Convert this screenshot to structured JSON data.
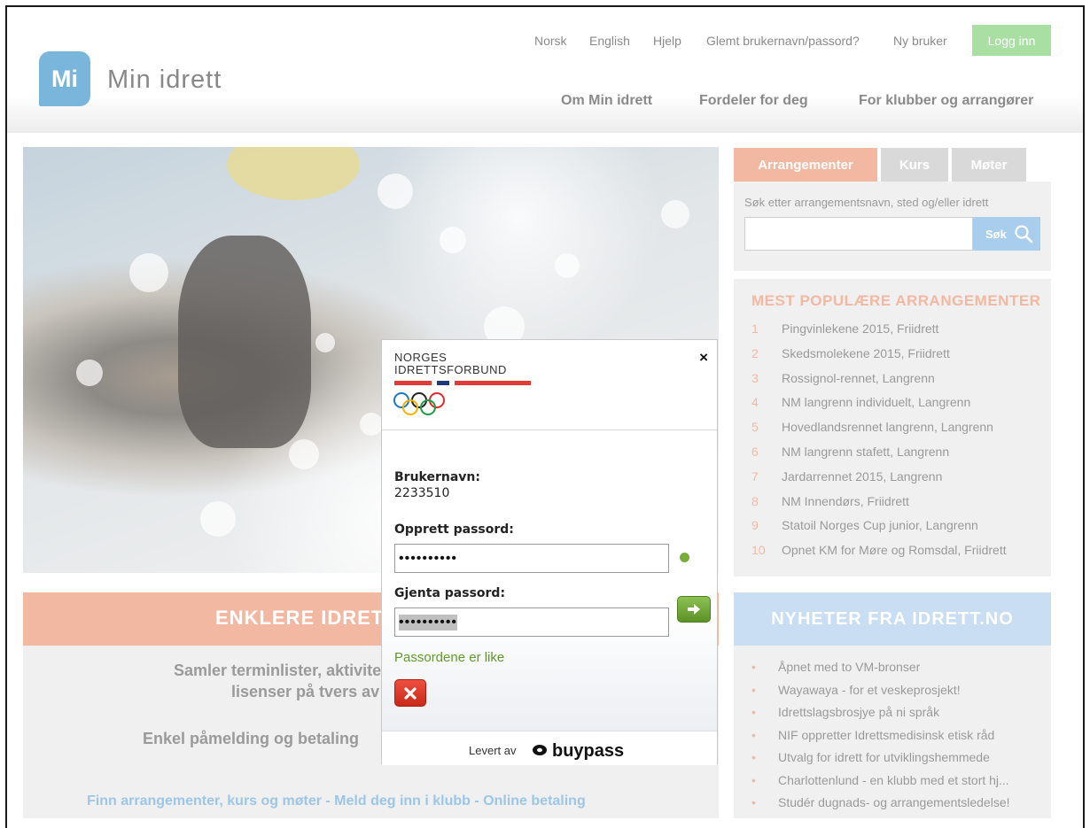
{
  "header": {
    "logo_badge": "Mi",
    "logo_text": "Min idrett",
    "top_links": [
      "Norsk",
      "English",
      "Hjelp",
      "Glemt brukernavn/passord?",
      "Ny bruker"
    ],
    "login_label": "Logg inn",
    "main_nav": [
      "Om Min idrett",
      "Fordeler for deg",
      "For klubber og arrangører"
    ]
  },
  "hero": {
    "tagline": "ENKLERE IDRETT",
    "line1": "Samler terminlister, aktiviteter og",
    "line2": "lisenser på tvers av idretter",
    "line3": "Enkel påmelding og betaling",
    "footer_links": "Finn arrangementer, kurs og møter - Meld deg inn i klubb - Online betaling"
  },
  "search": {
    "tabs": [
      "Arrangementer",
      "Kurs",
      "Møter"
    ],
    "active_tab": 0,
    "hint": "Søk etter arrangementsnavn, sted og/eller idrett",
    "input_value": "",
    "button_label": "Søk"
  },
  "popular": {
    "title": "MEST POPULÆRE ARRANGEMENTER",
    "items": [
      {
        "num": "1",
        "name": "Pingvinlekene 2015, Friidrett"
      },
      {
        "num": "2",
        "name": "Skedsmolekene 2015, Friidrett"
      },
      {
        "num": "3",
        "name": "Rossignol-rennet, Langrenn"
      },
      {
        "num": "4",
        "name": "NM langrenn individuelt, Langrenn"
      },
      {
        "num": "5",
        "name": "Hovedlandsrennet langrenn, Langrenn"
      },
      {
        "num": "6",
        "name": "NM langrenn stafett, Langrenn"
      },
      {
        "num": "7",
        "name": "Jardarrennet 2015, Langrenn"
      },
      {
        "num": "8",
        "name": "NM Innendørs, Friidrett"
      },
      {
        "num": "9",
        "name": "Statoil Norges Cup junior, Langrenn"
      },
      {
        "num": "10",
        "name": "Opnet KM for Møre og Romsdal, Friidrett"
      }
    ]
  },
  "news": {
    "title": "NYHETER FRA IDRETT.NO",
    "bullet": "•",
    "items": [
      "Åpnet med to VM-bronser",
      "Wayawaya - for et veskeprosjekt!",
      "Idrettslagsbrosjye på ni språk",
      "NIF oppretter Idrettsmedisinsk etisk råd",
      "Utvalg for idrett for utviklingshemmede",
      "Charlottenlund - en klubb med et stort hj...",
      "Studér dugnads- og arrangementsledelse!"
    ]
  },
  "modal": {
    "org_line1": "NORGES",
    "org_line2": "IDRETTSFORBUND",
    "close_icon": "×",
    "username_label": "Brukernavn:",
    "username_value": "2233510",
    "create_pw_label": "Opprett passord:",
    "create_pw_value": "••••••••••",
    "repeat_pw_label": "Gjenta passord:",
    "repeat_pw_value": "••••••••••",
    "match_message": "Passordene er like",
    "provided_by": "Levert av",
    "provider": "buypass"
  },
  "colors": {
    "accent_salmon": "#f3b8a2",
    "accent_blue": "#c9ddf3",
    "login_green": "#a9dfa2",
    "ok_green": "#79ad3a",
    "cancel_red": "#d8321f"
  }
}
